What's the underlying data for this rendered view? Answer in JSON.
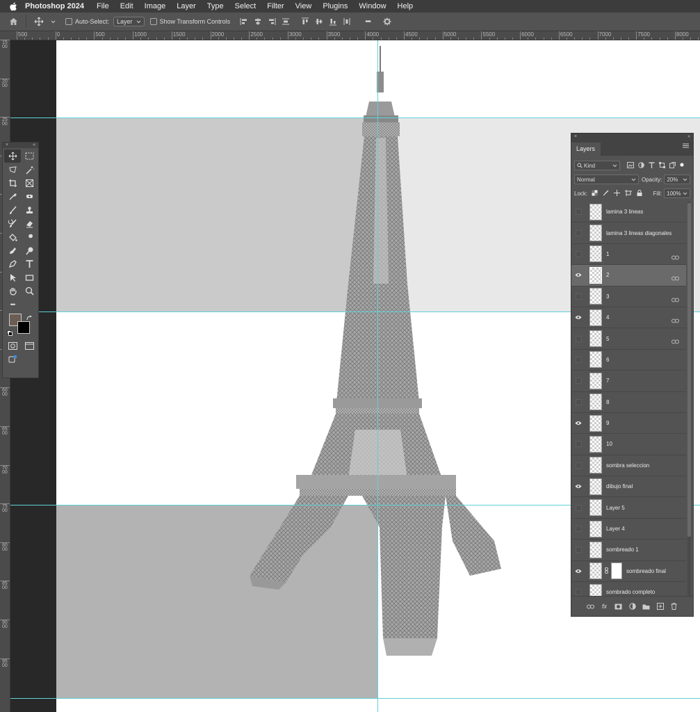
{
  "menubar": {
    "app_name": "Photoshop 2024",
    "items": [
      "File",
      "Edit",
      "Image",
      "Layer",
      "Type",
      "Select",
      "Filter",
      "View",
      "Plugins",
      "Window",
      "Help"
    ]
  },
  "options_bar": {
    "auto_select_label": "Auto-Select:",
    "auto_select_value": "Layer",
    "show_transform_label": "Show Transform Controls",
    "more_label": "•••"
  },
  "ruler": {
    "h_labels": [
      "500",
      "0",
      "500",
      "1000",
      "1500",
      "2000",
      "2500",
      "3000",
      "3500",
      "4000",
      "4500",
      "5000",
      "5500",
      "6000",
      "6500",
      "7000",
      "7500",
      "8000"
    ],
    "v_labels": [
      "1500",
      "2000",
      "2500",
      "3000",
      "3500",
      "4000",
      "4500",
      "5000",
      "5500",
      "6000",
      "6500",
      "7000",
      "7500",
      "8000",
      "8500",
      "9000",
      "9500"
    ]
  },
  "toolbox": {
    "more_label": "•••"
  },
  "layers_panel": {
    "tab": "Layers",
    "filter_kind": "Kind",
    "blend_mode": "Normal",
    "opacity_label": "Opacity:",
    "opacity_value": "20%",
    "lock_label": "Lock:",
    "fill_label": "Fill:",
    "fill_value": "100%",
    "layers": [
      {
        "name": "lamina 3 lineas",
        "visible": false,
        "linked": false,
        "selected": false
      },
      {
        "name": "lamina 3 lineas diagonales",
        "visible": false,
        "linked": false,
        "selected": false
      },
      {
        "name": "1",
        "visible": false,
        "linked": true,
        "selected": false
      },
      {
        "name": "2",
        "visible": true,
        "linked": true,
        "selected": true
      },
      {
        "name": "3",
        "visible": false,
        "linked": true,
        "selected": false
      },
      {
        "name": "4",
        "visible": true,
        "linked": true,
        "selected": false
      },
      {
        "name": "5",
        "visible": false,
        "linked": true,
        "selected": false
      },
      {
        "name": "6",
        "visible": false,
        "linked": false,
        "selected": false
      },
      {
        "name": "7",
        "visible": false,
        "linked": false,
        "selected": false
      },
      {
        "name": "8",
        "visible": false,
        "linked": false,
        "selected": false
      },
      {
        "name": "9",
        "visible": true,
        "linked": false,
        "selected": false
      },
      {
        "name": "10",
        "visible": false,
        "linked": false,
        "selected": false
      },
      {
        "name": "sombra seleccion",
        "visible": false,
        "linked": false,
        "selected": false
      },
      {
        "name": "dibujo final",
        "visible": true,
        "linked": false,
        "selected": false
      },
      {
        "name": "Layer 5",
        "visible": false,
        "linked": false,
        "selected": false
      },
      {
        "name": "Layer 4",
        "visible": false,
        "linked": false,
        "selected": false
      },
      {
        "name": "sombreado 1",
        "visible": false,
        "linked": false,
        "selected": false
      },
      {
        "name": "sombreado final",
        "visible": true,
        "linked": false,
        "selected": false,
        "has_mask": true
      },
      {
        "name": "sombrado completo",
        "visible": false,
        "linked": false,
        "selected": false
      }
    ]
  },
  "colors": {
    "foreground": "#6b5d54",
    "background": "#000000",
    "guide": "#5fd2d9"
  }
}
